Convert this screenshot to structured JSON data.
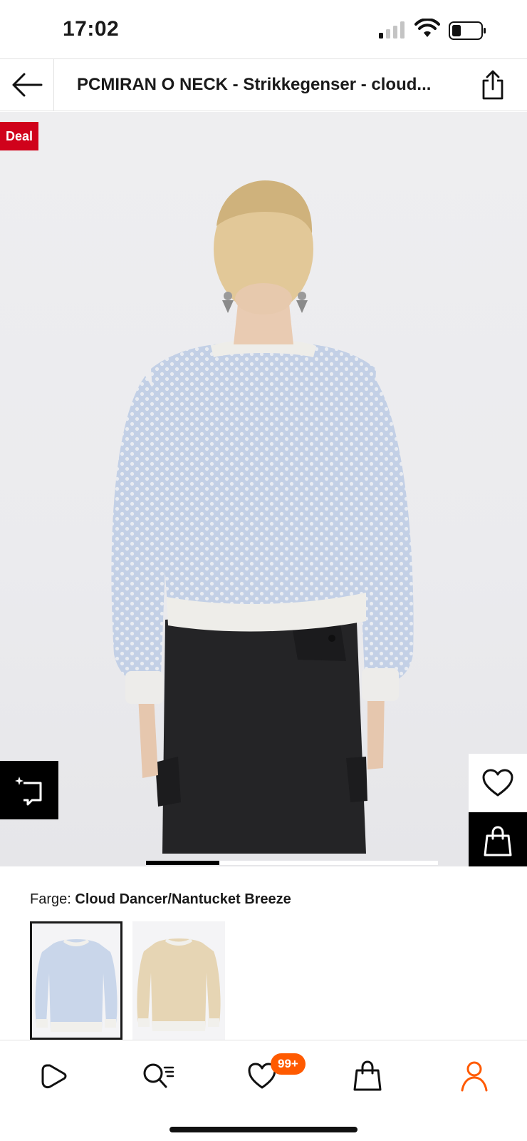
{
  "status_bar": {
    "time": "17:02"
  },
  "header": {
    "title": "PCMIRAN O NECK - Strikkegenser - cloud..."
  },
  "product": {
    "deal_badge": "Deal",
    "gallery_progress": 0.25
  },
  "color": {
    "label": "Farge:",
    "value": "Cloud Dancer/Nantucket Breeze",
    "swatches": [
      {
        "name": "Cloud Dancer/Nantucket Breeze",
        "color": "#c9d6ea",
        "selected": true
      },
      {
        "name": "beige",
        "color": "#e6d5b4",
        "selected": false
      }
    ]
  },
  "bottom_nav": {
    "items": [
      "home-icon",
      "search-icon",
      "wishlist-icon",
      "bag-icon",
      "profile-icon"
    ],
    "wishlist_badge": "99+",
    "active": "profile-icon"
  },
  "colors": {
    "accent": "#ff5a00",
    "deal": "#d0021b"
  }
}
